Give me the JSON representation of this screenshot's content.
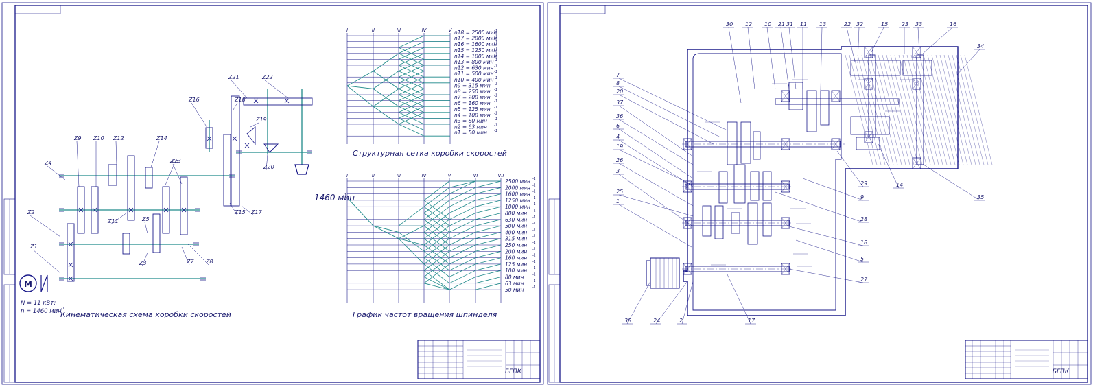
{
  "sheet_left": {
    "kin_gear_labels": [
      "Z1",
      "Z2",
      "Z3",
      "Z4",
      "Z5",
      "Z6",
      "Z7",
      "Z8",
      "Z9",
      "Z10",
      "Z11",
      "Z12",
      "Z13",
      "Z14",
      "Z15",
      "Z16",
      "Z17",
      "Z18",
      "Z19",
      "Z20",
      "Z21",
      "Z22"
    ],
    "motor_symbol": "M",
    "motor_power": "N = 11 кВт;",
    "motor_speed": "n = 1460 мин",
    "kin_caption": "Кинематическая схема коробки скоростей",
    "struct_shafts": [
      "I",
      "II",
      "III",
      "IV",
      "V"
    ],
    "struct_speeds": [
      "n18 = 2500 мин",
      "n17 = 2000 мин",
      "n16 = 1600 мин",
      "n15 = 1250 мин",
      "n14 = 1000 мин",
      "n13 = 800 мин",
      "n12 = 630 мин",
      "n11 = 500 мин",
      "n10 = 400 мин",
      "n9 = 315 мин",
      "n8 = 250 мин",
      "n7 = 200 мин",
      "n6 = 160 мин",
      "n5 = 125 мин",
      "n4 = 100 мин",
      "n3 = 80 мин",
      "n2 = 63 мин",
      "n1 = 50 мин"
    ],
    "struct_caption": "Структурная сетка коробки скоростей",
    "graph_shafts": [
      "I",
      "II",
      "III",
      "IV",
      "V",
      "VI",
      "VII"
    ],
    "graph_speeds": [
      "2500 мин",
      "2000 мин",
      "1600 мин",
      "1250 мин",
      "1000 мин",
      "800 мин",
      "630 мин",
      "500 мин",
      "400 мин",
      "315 мин",
      "250 мин",
      "200 мин",
      "160 мин",
      "125 мин",
      "100 мин",
      "80 мин",
      "63 мин",
      "50 мин"
    ],
    "graph_input": "1460 мин",
    "graph_caption": "График частот вращения шпинделя",
    "stamp_org": "БГПК"
  },
  "sheet_right": {
    "part_numbers": [
      "1",
      "2",
      "3",
      "4",
      "5",
      "6",
      "7",
      "8",
      "9",
      "10",
      "11",
      "12",
      "13",
      "14",
      "15",
      "16",
      "17",
      "18",
      "19",
      "20",
      "21",
      "22",
      "23",
      "24",
      "25",
      "26",
      "27",
      "28",
      "29",
      "30",
      "31",
      "32",
      "33",
      "34",
      "35",
      "36",
      "37",
      "38"
    ],
    "stamp_org": "БГПК"
  },
  "colors": {
    "line": "#1a1a8a",
    "teal": "#1f8a8a"
  }
}
